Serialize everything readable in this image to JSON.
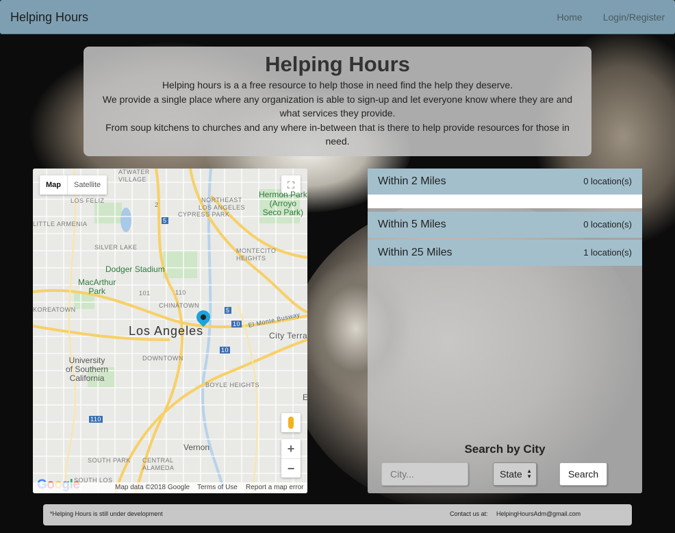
{
  "navbar": {
    "brand": "Helping Hours",
    "links": [
      "Home",
      "Login/Register"
    ]
  },
  "hero": {
    "title": "Helping Hours",
    "lines": [
      "Helping hours is a a free resource to help those in need find the help they deserve.",
      "We provide a single place where any organization is able to sign-up and let everyone know where they are and what services they provide.",
      "From soup kitchens to churches and any where in-between that is there to help provide resources for those in need."
    ]
  },
  "map": {
    "type_buttons": [
      "Map",
      "Satellite"
    ],
    "zoom_in": "+",
    "zoom_out": "−",
    "labels": {
      "atwater": "ATWATER\nVILLAGE",
      "los_feliz": "LOS FELIZ",
      "little_armenia": "LITTLE ARMENIA",
      "silver_lake": "SILVER LAKE",
      "north_east_la": "NORTHEAST\nLOS ANGELES",
      "cypress_park": "CYPRESS PARK",
      "hermon_park": "Hermon Park\n(Arroyo\nSeco Park)",
      "montecito": "MONTECITO\nHEIGHTS",
      "dodger": "Dodger Stadium",
      "macarthur": "MacArthur\nPark",
      "koreatown": "KOREATOWN",
      "chinatown": "CHINATOWN",
      "los_angeles": "Los Angeles",
      "el_monte": "El Monte Busway",
      "city_terrace": "City Terra",
      "downtown": "DOWNTOWN",
      "usc": "University\nof Southern\nCalifornia",
      "boyle": "BOYLE HEIGHTS",
      "south_park": "SOUTH PARK",
      "central_alameda": "CENTRAL\nALAMEDA",
      "vernon": "Vernon",
      "south_los": "SOUTH LOS",
      "hwy_2": "2",
      "hwy_5a": "5",
      "hwy_5b": "5",
      "hwy_101": "101",
      "hwy_110a": "110",
      "hwy_110b": "110",
      "hwy_10a": "10",
      "hwy_10b": "10",
      "e_letter": "E"
    },
    "logo": "Google",
    "footer": [
      "Map data ©2018 Google",
      "Terms of Use",
      "Report a map error"
    ]
  },
  "locations": [
    {
      "label": "Within 2 Miles",
      "count": "0 location(s)"
    },
    {
      "label": "Within 5 Miles",
      "count": "0 location(s)"
    },
    {
      "label": "Within 25 Miles",
      "count": "1 location(s)"
    }
  ],
  "search": {
    "title": "Search by City",
    "city_placeholder": "City...",
    "state_value": "State",
    "button": "Search"
  },
  "footer": {
    "note": "*Helping Hours is still under development",
    "contact_label": "Contact us at:",
    "email": "HelpingHoursAdm@gmail.com"
  },
  "colors": {
    "navbar": "#7d9fb1",
    "location_row": "#a3bfcc",
    "map_pin": "#1aa4dd"
  }
}
